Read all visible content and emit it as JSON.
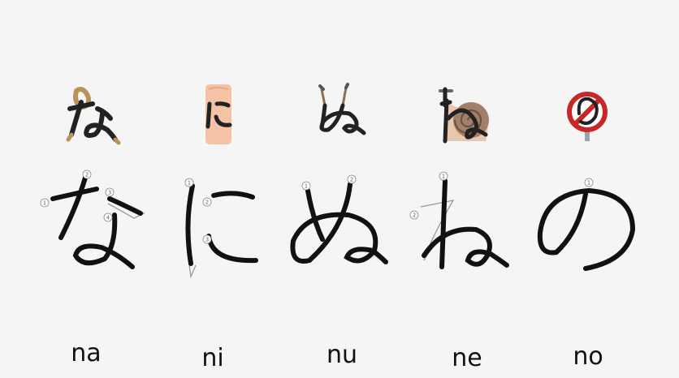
{
  "kana": [
    {
      "char": "な",
      "romaji": "na",
      "mnemonic": "rope-icon"
    },
    {
      "char": "に",
      "romaji": "ni",
      "mnemonic": "knee-icon"
    },
    {
      "char": "ぬ",
      "romaji": "nu",
      "mnemonic": "noodles-icon"
    },
    {
      "char": "ね",
      "romaji": "ne",
      "mnemonic": "snail-icon"
    },
    {
      "char": "の",
      "romaji": "no",
      "mnemonic": "no-sign-icon"
    }
  ],
  "stroke_numbers": {
    "na": [
      "1",
      "2",
      "3",
      "4"
    ],
    "ni": [
      "1",
      "2",
      "3"
    ],
    "nu": [
      "1",
      "2"
    ],
    "ne": [
      "1",
      "2"
    ],
    "no": [
      "1"
    ]
  },
  "colors": {
    "background": "#f5f5f5",
    "stroke": "#111111",
    "rope": "#b8925a",
    "knee": "#f4c3a6",
    "snail_shell": "#a0806a",
    "no_sign_red": "#c62828"
  }
}
